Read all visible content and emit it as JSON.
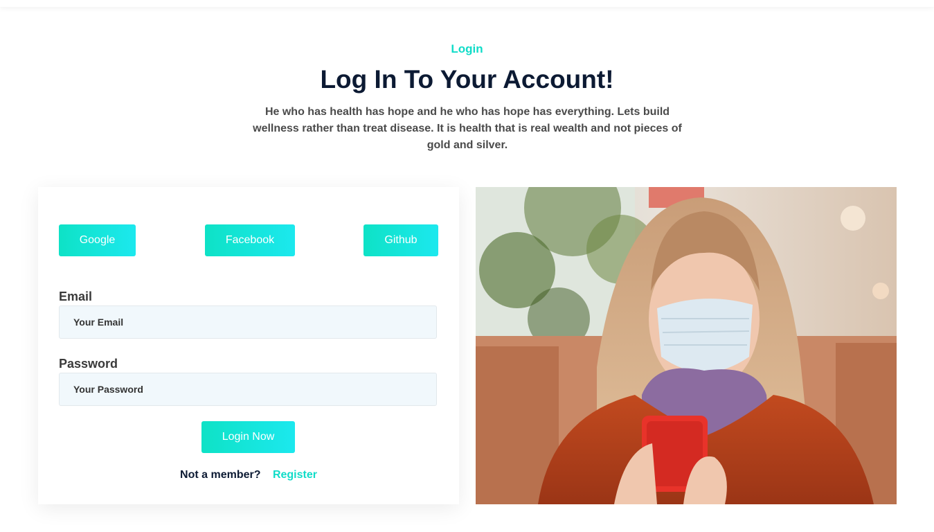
{
  "header": {
    "kicker": "Login",
    "title": "Log In To Your Account!",
    "intro": "He who has health has hope and he who has hope has everything. Lets build wellness rather than treat disease. It is health that is real wealth and not pieces of gold and silver."
  },
  "social": {
    "google": "Google",
    "facebook": "Facebook",
    "github": "Github"
  },
  "form": {
    "email_label": "Email",
    "email_placeholder": "Your Email",
    "email_value": "",
    "password_label": "Password",
    "password_placeholder": "Your Password",
    "password_value": "",
    "submit_label": "Login Now",
    "member_question": "Not a member?",
    "register_label": "Register"
  },
  "colors": {
    "accent": "#10dcc8",
    "heading": "#0c1a33",
    "field_bg": "#f1f8fc"
  },
  "icons": {
    "hero_image": "woman-with-mask-and-phone-photo"
  }
}
